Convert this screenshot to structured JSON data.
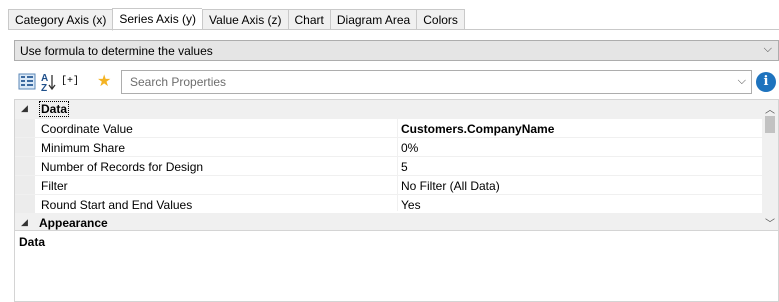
{
  "tabs": [
    {
      "label": "Category Axis (x)",
      "active": false
    },
    {
      "label": "Series Axis (y)",
      "active": true
    },
    {
      "label": "Value Axis (z)",
      "active": false
    },
    {
      "label": "Chart",
      "active": false
    },
    {
      "label": "Diagram Area",
      "active": false
    },
    {
      "label": "Colors",
      "active": false
    }
  ],
  "formula_dropdown": {
    "value": "Use formula to determine the values"
  },
  "toolbar": {
    "icons": [
      "categorized-sort-icon",
      "alphabetical-sort-icon",
      "expand-all-icon",
      "favorites-star-icon"
    ],
    "expand_label": "[+]",
    "sort_az_label": "A↓Z",
    "search": {
      "placeholder": "Search Properties",
      "value": ""
    },
    "info_label": "i"
  },
  "property_grid": {
    "categories": [
      {
        "name": "Data",
        "selected": true,
        "expanded": true,
        "properties": [
          {
            "name": "Coordinate Value",
            "value": "Customers.CompanyName",
            "bold": true
          },
          {
            "name": "Minimum Share",
            "value": "0%",
            "bold": false
          },
          {
            "name": "Number of Records for Design",
            "value": "5",
            "bold": false
          },
          {
            "name": "Filter",
            "value": "No Filter (All Data)",
            "bold": false
          },
          {
            "name": "Round Start and End Values",
            "value": "Yes",
            "bold": false
          }
        ]
      },
      {
        "name": "Appearance",
        "selected": false,
        "expanded": true,
        "properties": []
      }
    ]
  },
  "description": {
    "title": "Data",
    "text": ""
  },
  "colors": {
    "accent": "#1e73be",
    "star": "#f4b323",
    "category_bg": "#f0f0f0"
  }
}
